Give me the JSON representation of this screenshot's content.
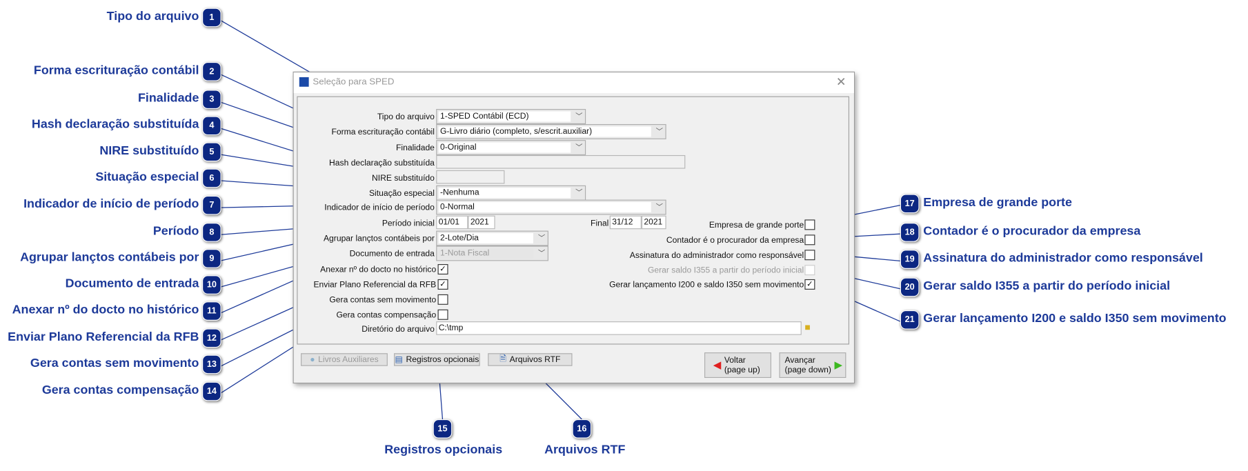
{
  "callouts_left": [
    {
      "n": "1",
      "label": "Tipo do arquivo"
    },
    {
      "n": "2",
      "label": "Forma escrituração contábil"
    },
    {
      "n": "3",
      "label": "Finalidade"
    },
    {
      "n": "4",
      "label": "Hash declaração substituída"
    },
    {
      "n": "5",
      "label": "NIRE substituído"
    },
    {
      "n": "6",
      "label": "Situação especial"
    },
    {
      "n": "7",
      "label": "Indicador de início de período"
    },
    {
      "n": "8",
      "label": "Período"
    },
    {
      "n": "9",
      "label": "Agrupar lançtos contábeis por"
    },
    {
      "n": "10",
      "label": "Documento de entrada"
    },
    {
      "n": "11",
      "label": "Anexar nº do docto no histórico"
    },
    {
      "n": "12",
      "label": "Enviar Plano Referencial da RFB"
    },
    {
      "n": "13",
      "label": "Gera contas sem movimento"
    },
    {
      "n": "14",
      "label": "Gera contas compensação"
    }
  ],
  "callouts_bottom": [
    {
      "n": "15",
      "label": "Registros opcionais"
    },
    {
      "n": "16",
      "label": "Arquivos RTF"
    }
  ],
  "callouts_right": [
    {
      "n": "17",
      "label": "Empresa de grande porte"
    },
    {
      "n": "18",
      "label": "Contador é o procurador da empresa"
    },
    {
      "n": "19",
      "label": "Assinatura do administrador como responsável"
    },
    {
      "n": "20",
      "label": "Gerar saldo I355 a partir do período inicial"
    },
    {
      "n": "21",
      "label": "Gerar lançamento I200 e saldo I350 sem movimento"
    }
  ],
  "dialog": {
    "title": "Seleção para SPED",
    "tipo_label": "Tipo do arquivo",
    "tipo_value": "1-SPED Contábil (ECD)",
    "forma_label": "Forma escrituração contábil",
    "forma_value": "G-Livro diário (completo, s/escrit.auxiliar)",
    "finalidade_label": "Finalidade",
    "finalidade_value": "0-Original",
    "hash_label": "Hash declaração substituída",
    "hash_value": "",
    "nire_label": "NIRE substituído",
    "nire_value": "",
    "situacao_label": "Situação especial",
    "situacao_value": "-Nenhuma",
    "indicador_label": "Indicador de início de período",
    "indicador_value": "0-Normal",
    "periodo_label": "Período inicial",
    "periodo_ini_dm": "01/01",
    "periodo_ini_y": "2021",
    "final_label": "Final",
    "periodo_fim_dm": "31/12",
    "periodo_fim_y": "2021",
    "agrupar_label": "Agrupar lançtos contábeis por",
    "agrupar_value": "2-Lote/Dia",
    "documento_label": "Documento de entrada",
    "documento_value": "1-Nota Fiscal",
    "anexar_label": "Anexar nº do docto no histórico",
    "anexar_checked": true,
    "enviar_label": "Enviar Plano Referencial da RFB",
    "enviar_checked": true,
    "semmov_label": "Gera contas sem movimento",
    "semmov_checked": false,
    "comp_label": "Gera contas compensação",
    "comp_checked": false,
    "dir_label": "Diretório do arquivo",
    "dir_value": "C:\\tmp",
    "grande_label": "Empresa de grande porte",
    "grande_checked": false,
    "contador_label": "Contador é o procurador da empresa",
    "contador_checked": false,
    "assinatura_label": "Assinatura do administrador como responsável",
    "assinatura_checked": false,
    "i355_label": "Gerar saldo I355 a partir do período inicial",
    "i355_checked": false,
    "i200_label": "Gerar lançamento I200 e saldo I350 sem movimento",
    "i200_checked": true,
    "btn_livros": "Livros Auxiliares",
    "btn_registros": "Registros opcionais",
    "btn_rtf": "Arquivos RTF",
    "btn_voltar": "Voltar",
    "btn_voltar_sub": "(page up)",
    "btn_avancar": "Avançar",
    "btn_avancar_sub": "(page down)"
  },
  "colors": {
    "callout_text": "#1d3a99",
    "badge": "#0c2782",
    "leader_line": "#1d3a99"
  }
}
